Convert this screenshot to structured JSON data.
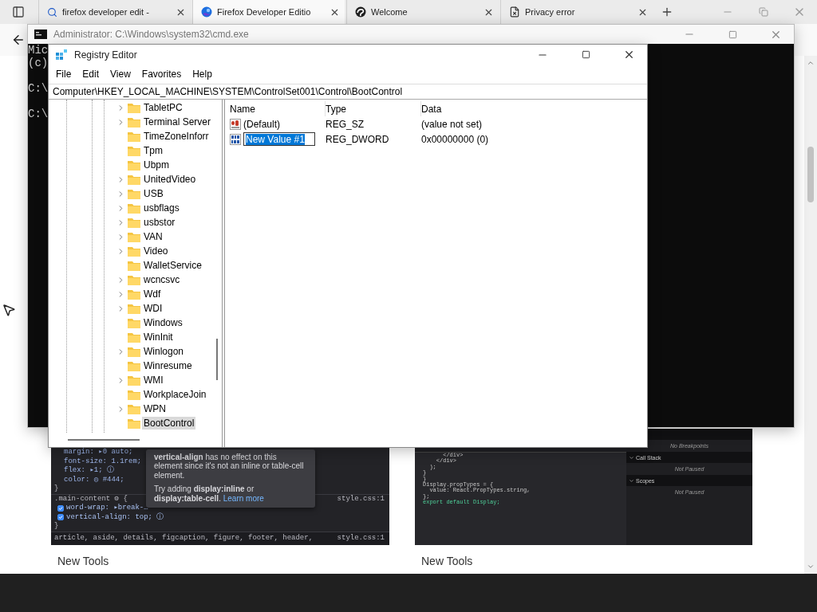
{
  "browser": {
    "tabs": [
      {
        "kind": "search",
        "title": "firefox developer edit -",
        "selected": false
      },
      {
        "kind": "browser",
        "title": "Firefox Developer Editio",
        "selected": true
      },
      {
        "kind": "swirl",
        "title": "Welcome",
        "selected": false
      },
      {
        "kind": "document",
        "title": "Privacy error",
        "selected": false
      }
    ],
    "cards": [
      {
        "kind": "inspector",
        "caption": "New Tools",
        "code_lines": [
          "margin: ▸0 auto;",
          "font-size: 1.1rem;",
          "flex: ▸1; ⓘ",
          "color: ◎ #444;",
          "}"
        ],
        "selector": ".main-content ⚙ {",
        "file": "style.css:1",
        "declarations": [
          {
            "text": "word-wrap: ▸break-…",
            "checked": true
          },
          {
            "text": "vertical-align: top; ⓘ",
            "checked": true
          }
        ],
        "closing": "}",
        "next_rule": "article, aside, details, figcaption, figure, footer, header,",
        "next_file": "style.css:1",
        "tooltip": {
          "message": "**vertical-align** has no effect on this element since it's not an inline or table-cell element.",
          "hint": "Try adding **display:inline** or **display:table-cell**.",
          "link": "Learn more"
        }
      },
      {
        "kind": "debugger",
        "caption": "New Tools",
        "code_lines": [
          "      </div>",
          "    </div>",
          "  );",
          "}",
          "}",
          "Display.propTypes = {",
          "  value: React.PropTypes.string,",
          "};",
          "export default Display;"
        ],
        "sections": [
          {
            "message": "No Breakpoints"
          },
          {
            "heading": "Call Stack",
            "message": "Not Paused"
          },
          {
            "heading": "Scopes",
            "message": "Not Paused"
          }
        ]
      }
    ]
  },
  "cmd": {
    "title": "Administrator: C:\\Windows\\system32\\cmd.exe",
    "blocks": [
      [
        "Mic",
        "(c)"
      ],
      [
        "C:\\"
      ],
      [
        "C:\\"
      ]
    ]
  },
  "regedit": {
    "title": "Registry Editor",
    "menu": [
      "File",
      "Edit",
      "View",
      "Favorites",
      "Help"
    ],
    "address": "Computer\\HKEY_LOCAL_MACHINE\\SYSTEM\\ControlSet001\\Control\\BootControl",
    "tree": [
      {
        "label": "TabletPC",
        "expandable": true,
        "selected": false
      },
      {
        "label": "Terminal Server",
        "expandable": true,
        "selected": false
      },
      {
        "label": "TimeZoneInforr",
        "expandable": false,
        "selected": false
      },
      {
        "label": "Tpm",
        "expandable": false,
        "selected": false
      },
      {
        "label": "Ubpm",
        "expandable": false,
        "selected": false
      },
      {
        "label": "UnitedVideo",
        "expandable": true,
        "selected": false
      },
      {
        "label": "USB",
        "expandable": true,
        "selected": false
      },
      {
        "label": "usbflags",
        "expandable": true,
        "selected": false
      },
      {
        "label": "usbstor",
        "expandable": true,
        "selected": false
      },
      {
        "label": "VAN",
        "expandable": true,
        "selected": false
      },
      {
        "label": "Video",
        "expandable": true,
        "selected": false
      },
      {
        "label": "WalletService",
        "expandable": false,
        "selected": false
      },
      {
        "label": "wcncsvc",
        "expandable": true,
        "selected": false
      },
      {
        "label": "Wdf",
        "expandable": true,
        "selected": false
      },
      {
        "label": "WDI",
        "expandable": true,
        "selected": false
      },
      {
        "label": "Windows",
        "expandable": false,
        "selected": false
      },
      {
        "label": "WinInit",
        "expandable": false,
        "selected": false
      },
      {
        "label": "Winlogon",
        "expandable": true,
        "selected": false
      },
      {
        "label": "Winresume",
        "expandable": false,
        "selected": false
      },
      {
        "label": "WMI",
        "expandable": true,
        "selected": false
      },
      {
        "label": "WorkplaceJoin",
        "expandable": false,
        "selected": false
      },
      {
        "label": "WPN",
        "expandable": true,
        "selected": false
      },
      {
        "label": "BootControl",
        "expandable": false,
        "selected": true
      }
    ],
    "columns": [
      "Name",
      "Type",
      "Data"
    ],
    "values": [
      {
        "kind": "string",
        "name": "(Default)",
        "type": "REG_SZ",
        "data": "(value not set)",
        "editing": false
      },
      {
        "kind": "dword",
        "name": "New Value #1",
        "type": "REG_DWORD",
        "data": "0x00000000 (0)",
        "editing": true
      }
    ]
  }
}
